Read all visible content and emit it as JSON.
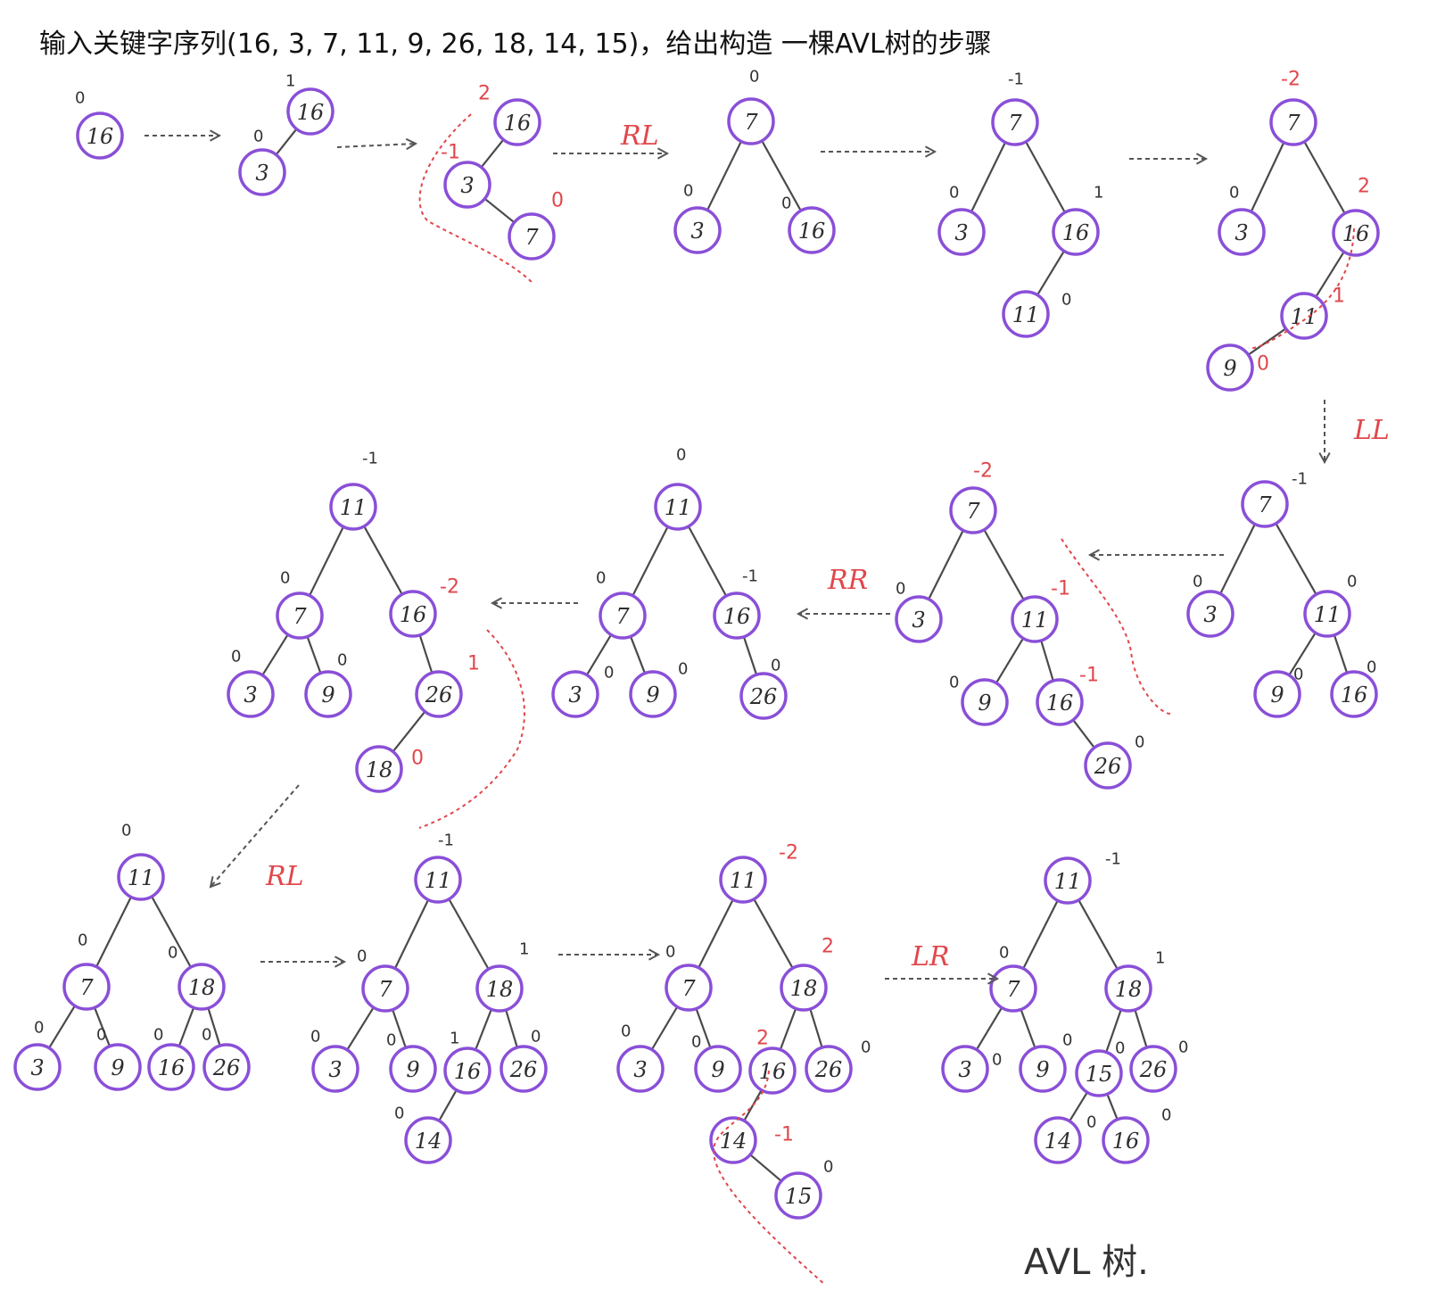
{
  "title": "输入关键字序列(16, 3, 7, 11, 9, 26, 18, 14, 15)，给出构造 一棵AVL树的步骤",
  "final_caption": "AVL 树.",
  "colors": {
    "node_stroke": "#8a4fd8",
    "balance_red": "#e0474c",
    "edge": "#4a4a4a"
  },
  "rotations": [
    "RL",
    "LL",
    "RR",
    "RL",
    "LR"
  ],
  "trees": [
    {
      "nodes": [
        {
          "key": "16",
          "bf": "0"
        }
      ],
      "edges": []
    },
    {
      "nodes": [
        {
          "key": "16",
          "bf": "1"
        },
        {
          "key": "3",
          "bf": "0"
        }
      ],
      "edges": [
        [
          0,
          1
        ]
      ]
    },
    {
      "nodes": [
        {
          "key": "16",
          "bf": "2",
          "red": true
        },
        {
          "key": "3",
          "bf": "-1",
          "red": true
        },
        {
          "key": "7",
          "bf": "0",
          "red": true
        }
      ],
      "edges": [
        [
          0,
          1
        ],
        [
          1,
          2
        ]
      ]
    },
    {
      "nodes": [
        {
          "key": "7",
          "bf": "0"
        },
        {
          "key": "3",
          "bf": "0"
        },
        {
          "key": "16",
          "bf": "0"
        }
      ],
      "edges": [
        [
          0,
          1
        ],
        [
          0,
          2
        ]
      ]
    },
    {
      "nodes": [
        {
          "key": "7",
          "bf": "-1"
        },
        {
          "key": "3",
          "bf": "0"
        },
        {
          "key": "16",
          "bf": "1"
        },
        {
          "key": "11",
          "bf": "0"
        }
      ],
      "edges": [
        [
          0,
          1
        ],
        [
          0,
          2
        ],
        [
          2,
          3
        ]
      ]
    },
    {
      "nodes": [
        {
          "key": "7",
          "bf": "-2",
          "red": true
        },
        {
          "key": "3",
          "bf": "0"
        },
        {
          "key": "16",
          "bf": "2",
          "red": true
        },
        {
          "key": "11",
          "bf": "1",
          "red": true
        },
        {
          "key": "9",
          "bf": "0",
          "red": true
        }
      ],
      "edges": [
        [
          0,
          1
        ],
        [
          0,
          2
        ],
        [
          2,
          3
        ],
        [
          3,
          4
        ]
      ]
    },
    {
      "nodes": [
        {
          "key": "7",
          "bf": "-1"
        },
        {
          "key": "3",
          "bf": "0"
        },
        {
          "key": "11",
          "bf": "0"
        },
        {
          "key": "9",
          "bf": "0"
        },
        {
          "key": "16",
          "bf": "0"
        }
      ],
      "edges": [
        [
          0,
          1
        ],
        [
          0,
          2
        ],
        [
          2,
          3
        ],
        [
          2,
          4
        ]
      ]
    },
    {
      "nodes": [
        {
          "key": "7",
          "bf": "-2",
          "red": true
        },
        {
          "key": "3",
          "bf": "0"
        },
        {
          "key": "11",
          "bf": "-1",
          "red": true
        },
        {
          "key": "9",
          "bf": "0"
        },
        {
          "key": "16",
          "bf": "-1",
          "red": true
        },
        {
          "key": "26",
          "bf": "0"
        }
      ],
      "edges": [
        [
          0,
          1
        ],
        [
          0,
          2
        ],
        [
          2,
          3
        ],
        [
          2,
          4
        ],
        [
          4,
          5
        ]
      ]
    },
    {
      "nodes": [
        {
          "key": "11",
          "bf": "0"
        },
        {
          "key": "7",
          "bf": "0"
        },
        {
          "key": "16",
          "bf": "-1"
        },
        {
          "key": "3",
          "bf": "0"
        },
        {
          "key": "9",
          "bf": "0"
        },
        {
          "key": "26",
          "bf": "0"
        }
      ],
      "edges": [
        [
          0,
          1
        ],
        [
          0,
          2
        ],
        [
          1,
          3
        ],
        [
          1,
          4
        ],
        [
          2,
          5
        ]
      ]
    },
    {
      "nodes": [
        {
          "key": "11",
          "bf": "-1"
        },
        {
          "key": "7",
          "bf": "0"
        },
        {
          "key": "16",
          "bf": "-2",
          "red": true
        },
        {
          "key": "3",
          "bf": "0"
        },
        {
          "key": "9",
          "bf": "0"
        },
        {
          "key": "26",
          "bf": "1",
          "red": true
        },
        {
          "key": "18",
          "bf": "0",
          "red": true
        }
      ],
      "edges": [
        [
          0,
          1
        ],
        [
          0,
          2
        ],
        [
          1,
          3
        ],
        [
          1,
          4
        ],
        [
          2,
          5
        ],
        [
          5,
          6
        ]
      ]
    },
    {
      "nodes": [
        {
          "key": "11",
          "bf": "0"
        },
        {
          "key": "7",
          "bf": "0"
        },
        {
          "key": "18",
          "bf": "0"
        },
        {
          "key": "3",
          "bf": "0"
        },
        {
          "key": "9",
          "bf": "0"
        },
        {
          "key": "16",
          "bf": "0"
        },
        {
          "key": "26",
          "bf": "0"
        }
      ],
      "edges": [
        [
          0,
          1
        ],
        [
          0,
          2
        ],
        [
          1,
          3
        ],
        [
          1,
          4
        ],
        [
          2,
          5
        ],
        [
          2,
          6
        ]
      ]
    },
    {
      "nodes": [
        {
          "key": "11",
          "bf": "-1"
        },
        {
          "key": "7",
          "bf": "0"
        },
        {
          "key": "18",
          "bf": "1"
        },
        {
          "key": "3",
          "bf": "0"
        },
        {
          "key": "9",
          "bf": "0"
        },
        {
          "key": "16",
          "bf": "1"
        },
        {
          "key": "26",
          "bf": "0"
        },
        {
          "key": "14",
          "bf": "0"
        }
      ],
      "edges": [
        [
          0,
          1
        ],
        [
          0,
          2
        ],
        [
          1,
          3
        ],
        [
          1,
          4
        ],
        [
          2,
          5
        ],
        [
          2,
          6
        ],
        [
          5,
          7
        ]
      ]
    },
    {
      "nodes": [
        {
          "key": "11",
          "bf": "-2",
          "red": true
        },
        {
          "key": "7",
          "bf": "0"
        },
        {
          "key": "18",
          "bf": "2",
          "red": true
        },
        {
          "key": "3",
          "bf": "0"
        },
        {
          "key": "9",
          "bf": "0"
        },
        {
          "key": "16",
          "bf": "2",
          "red": true
        },
        {
          "key": "26",
          "bf": "0"
        },
        {
          "key": "14",
          "bf": "-1",
          "red": true
        },
        {
          "key": "15",
          "bf": "0"
        }
      ],
      "edges": [
        [
          0,
          1
        ],
        [
          0,
          2
        ],
        [
          1,
          3
        ],
        [
          1,
          4
        ],
        [
          2,
          5
        ],
        [
          2,
          6
        ],
        [
          5,
          7
        ],
        [
          7,
          8
        ]
      ]
    },
    {
      "nodes": [
        {
          "key": "11",
          "bf": "-1"
        },
        {
          "key": "7",
          "bf": "0"
        },
        {
          "key": "18",
          "bf": "1"
        },
        {
          "key": "3",
          "bf": "0"
        },
        {
          "key": "9",
          "bf": "0"
        },
        {
          "key": "15",
          "bf": "0"
        },
        {
          "key": "26",
          "bf": "0"
        },
        {
          "key": "14",
          "bf": "0"
        },
        {
          "key": "16",
          "bf": "0"
        }
      ],
      "edges": [
        [
          0,
          1
        ],
        [
          0,
          2
        ],
        [
          1,
          3
        ],
        [
          1,
          4
        ],
        [
          2,
          5
        ],
        [
          2,
          6
        ],
        [
          5,
          7
        ],
        [
          5,
          8
        ]
      ]
    }
  ]
}
